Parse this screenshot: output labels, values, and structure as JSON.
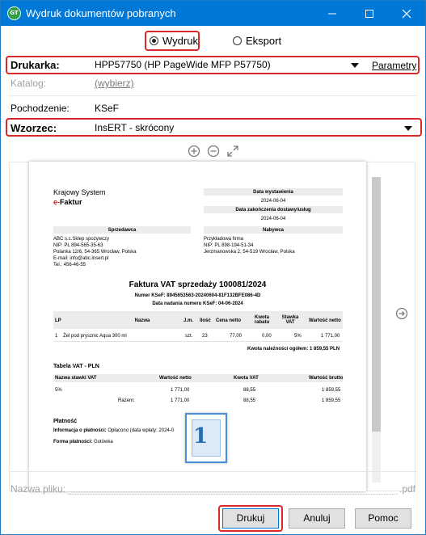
{
  "window": {
    "title": "Wydruk dokumentów pobranych",
    "app_icon_text": "GT",
    "controls": [
      "minimize",
      "maximize",
      "close"
    ]
  },
  "mode": {
    "options": [
      {
        "label": "Wydruk",
        "selected": true
      },
      {
        "label": "Eksport",
        "selected": false
      }
    ]
  },
  "form": {
    "printer_label": "Drukarka:",
    "printer_value": "HPP57750 (HP PageWide MFP P57750)",
    "parameters_link": "Parametry",
    "catalog_label": "Katalog:",
    "catalog_link": "(wybierz)",
    "origin_label": "Pochodzenie:",
    "origin_value": "KSeF",
    "template_label": "Wzorzec:",
    "template_value": "InsERT - skrócony"
  },
  "preview": {
    "tools": [
      "zoom-in-icon",
      "zoom-out-icon",
      "fit-icon"
    ],
    "scroll_fraction": 0.83,
    "doc": {
      "logo_line1": "Krajowy System",
      "logo_e": "e-",
      "logo_line2": "Faktur",
      "issue_date_label": "Data wystawienia",
      "issue_date": "2024-06-04",
      "delivery_date_label": "Data zakończenia dostawy/usług",
      "delivery_date": "2024-06-04",
      "seller_header": "Sprzedawca",
      "seller_lines": [
        "ABC s.c.Sklep spożywczy",
        "NIP: PL 894-565-35-63",
        "Polanka 12/6, 54-365 Wrocław, Polska",
        "E-mail: info@abc.insert.pl",
        "Tel.: 456-46-55"
      ],
      "buyer_header": "Nabywca",
      "buyer_lines": [
        "Przykładowa firma",
        "NIP: PL 898-194-51-34",
        "Jerzmanowska 2, 54-519 Wrocław, Polska"
      ],
      "invoice_title": "Faktura VAT sprzedaży 100081/2024",
      "ksef_number": "Numer KSeF: 8945653563-20240604-81F132BFE086-4D",
      "ksef_date": "Data nadania numeru KSeF: 04-06-2024",
      "items_headers": [
        "LP",
        "Nazwa",
        "J.m.",
        "Ilość",
        "Cena netto",
        "Kwota rabatu",
        "Stawka VAT",
        "Wartość netto"
      ],
      "items": [
        [
          "1",
          "Żel pod prysznic Aqua 300 ml",
          "szt.",
          "23",
          "77,00",
          "0,00",
          "5%",
          "1 771,00"
        ]
      ],
      "due_total": "Kwota należności ogółem: 1 859,55 PLN",
      "vat_table_title": "Tabela VAT - PLN",
      "vat_headers": [
        "Nazwa stawki VAT",
        "Wartość netto",
        "Kwota VAT",
        "Wartość brutto"
      ],
      "vat_rows": [
        [
          "5%",
          "1 771,00",
          "88,55",
          "1 859,55"
        ],
        [
          "Razem:",
          "1 771,00",
          "88,55",
          "1 859,55"
        ]
      ],
      "payment_title": "Płatność",
      "payment_info_label": "Informacja o płatności:",
      "payment_info_value": "Opłacono (data wpłaty: 2024-0",
      "payment_form_label": "Forma płatności:",
      "payment_form_value": "Gotówka",
      "thumbnail_number": "1"
    }
  },
  "filename": {
    "label": "Nazwa pliku:",
    "value": "",
    "extension": ".pdf"
  },
  "buttons": {
    "print": "Drukuj",
    "cancel": "Anuluj",
    "help": "Pomoc"
  },
  "colors": {
    "titlebar": "#0078d7",
    "highlight": "#d82a2a"
  }
}
